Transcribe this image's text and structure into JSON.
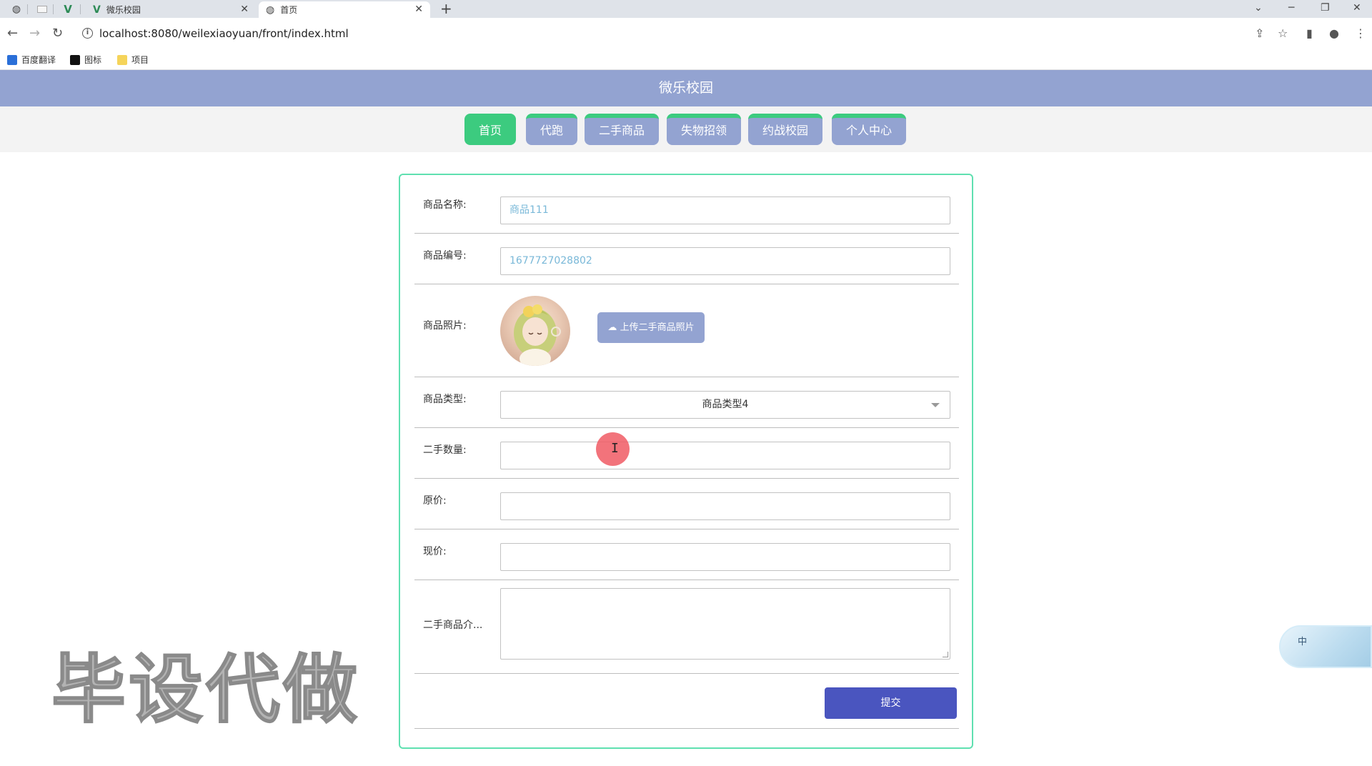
{
  "browser": {
    "tabs": [
      {
        "title": "微乐校园"
      },
      {
        "title": "首页"
      }
    ],
    "url": "localhost:8080/weilexiaoyuan/front/index.html",
    "bookmarks": [
      "百度翻译",
      "图标",
      "项目"
    ]
  },
  "site": {
    "title": "微乐校园",
    "nav": [
      "首页",
      "代跑",
      "二手商品",
      "失物招领",
      "约战校园",
      "个人中心"
    ],
    "active_nav": "首页"
  },
  "form": {
    "fields": {
      "name": {
        "label": "商品名称:",
        "value": "商品111"
      },
      "code": {
        "label": "商品编号:",
        "value": "1677727028802"
      },
      "photo": {
        "label": "商品照片:",
        "upload_label": "上传二手商品照片"
      },
      "type": {
        "label": "商品类型:",
        "value": "商品类型4"
      },
      "quantity": {
        "label": "二手数量:",
        "value": ""
      },
      "orig_price": {
        "label": "原价:",
        "value": ""
      },
      "price": {
        "label": "现价:",
        "value": ""
      },
      "intro": {
        "label": "二手商品介...",
        "value": ""
      }
    },
    "submit_label": "提交"
  },
  "overlay": {
    "watermark": "毕设代做",
    "ime_label": "中"
  }
}
